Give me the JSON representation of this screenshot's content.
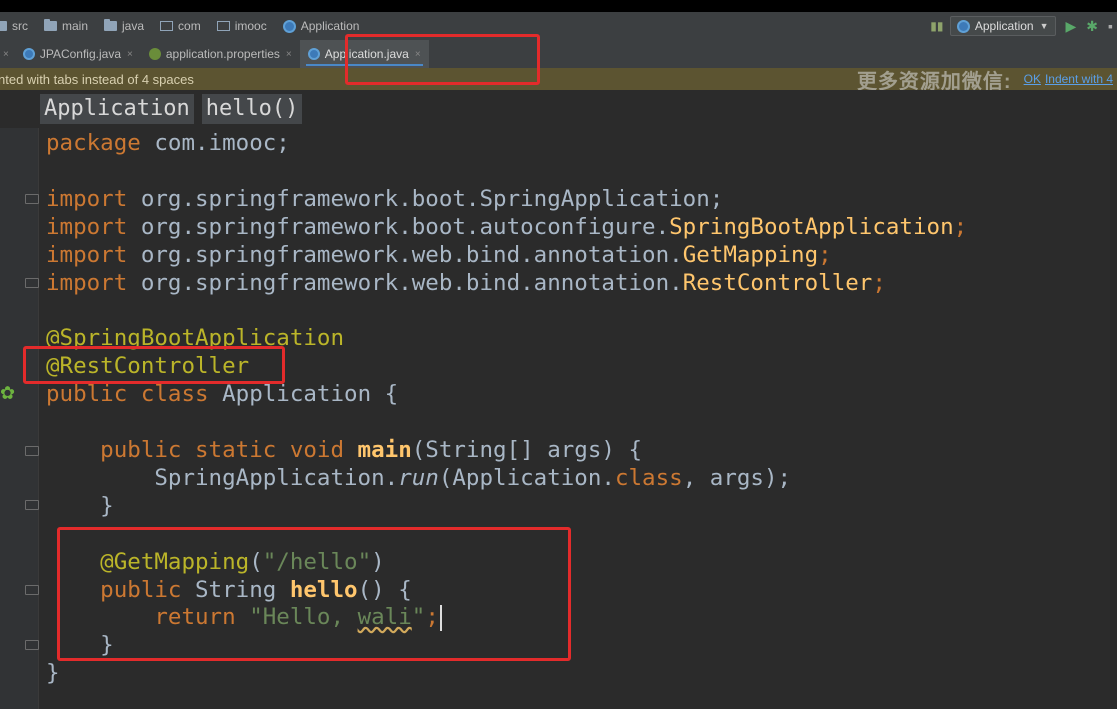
{
  "breadcrumbs": [
    "src",
    "main",
    "java",
    "com",
    "imooc",
    "Application"
  ],
  "run": {
    "config": "Application"
  },
  "tabs": [
    {
      "label": "JPAConfig.java",
      "active": false
    },
    {
      "label": "application.properties",
      "active": false
    },
    {
      "label": "Application.java",
      "active": true
    }
  ],
  "notice": {
    "text": "nted with tabs instead of 4 spaces",
    "watermark": "更多资源加微信:",
    "link_ok": "OK",
    "link_indent": "Indent with 4"
  },
  "editor_crumbs": [
    "Application",
    "hello()"
  ],
  "code": {
    "l1a": "package",
    "l1b": " com.imooc;",
    "l3a": "import",
    "l3b": " org.springframework.boot.SpringApplication;",
    "l4a": "import",
    "l4b": " org.springframework.boot.autoconfigure.",
    "l4c": "SpringBootApplication",
    "l4d": ";",
    "l5a": "import",
    "l5b": " org.springframework.web.bind.annotation.",
    "l5c": "GetMapping",
    "l5d": ";",
    "l6a": "import",
    "l6b": " org.springframework.web.bind.annotation.",
    "l6c": "RestController",
    "l6d": ";",
    "l8": "@SpringBootApplication",
    "l9": "@RestController",
    "l10a": "public class",
    "l10b": " Application {",
    "l12a": "    public static void",
    "l12b": " main",
    "l12c": "(String[] args) {",
    "l13a": "        SpringApplication.",
    "l13b": "run",
    "l13c": "(Application.",
    "l13d": "class",
    "l13e": ", args);",
    "l14": "    }",
    "l16a": "    @GetMapping",
    "l16b": "(",
    "l16c": "\"/hello\"",
    "l16d": ")",
    "l17a": "    public",
    "l17b": " String ",
    "l17c": "hello",
    "l17d": "() {",
    "l18a": "        return",
    "l18b": " \"Hello, ",
    "l18c": "wali",
    "l18d": "\"",
    "l18e": ";",
    "l19": "    }",
    "l20": "}"
  },
  "colors": {
    "keyword": "#cc7832",
    "annotation": "#bbb529",
    "string": "#6a8759",
    "default": "#a9b7c6",
    "highlight": "#e32b2b"
  }
}
